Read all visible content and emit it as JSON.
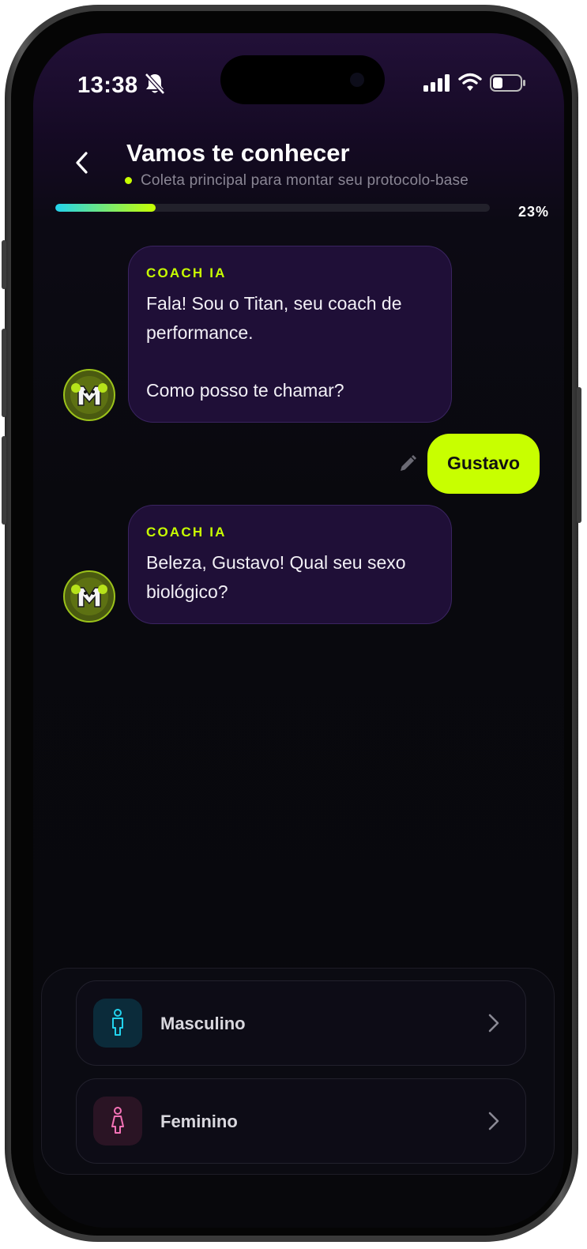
{
  "status_bar": {
    "time": "13:38"
  },
  "header": {
    "title": "Vamos te conhecer",
    "subtitle": "Coleta principal para montar seu protocolo-base"
  },
  "progress": {
    "value": 23,
    "label": "23%"
  },
  "messages": [
    {
      "sender": "coach",
      "label": "COACH IA",
      "lines": [
        "Fala! Sou o Titan, seu coach de",
        "performance.",
        "",
        "Como posso te chamar?"
      ]
    },
    {
      "sender": "user",
      "text": "Gustavo"
    },
    {
      "sender": "coach",
      "label": "COACH IA",
      "lines": [
        "Beleza, Gustavo! Qual seu sexo",
        "biológico?"
      ]
    }
  ],
  "options": [
    {
      "label": "Masculino",
      "icon": "male-person-icon",
      "color": "#22d3ee"
    },
    {
      "label": "Feminino",
      "icon": "female-person-icon",
      "color": "#f472b6"
    }
  ],
  "colors": {
    "accent": "#c8ff00",
    "bubble": "#1f0f37"
  }
}
